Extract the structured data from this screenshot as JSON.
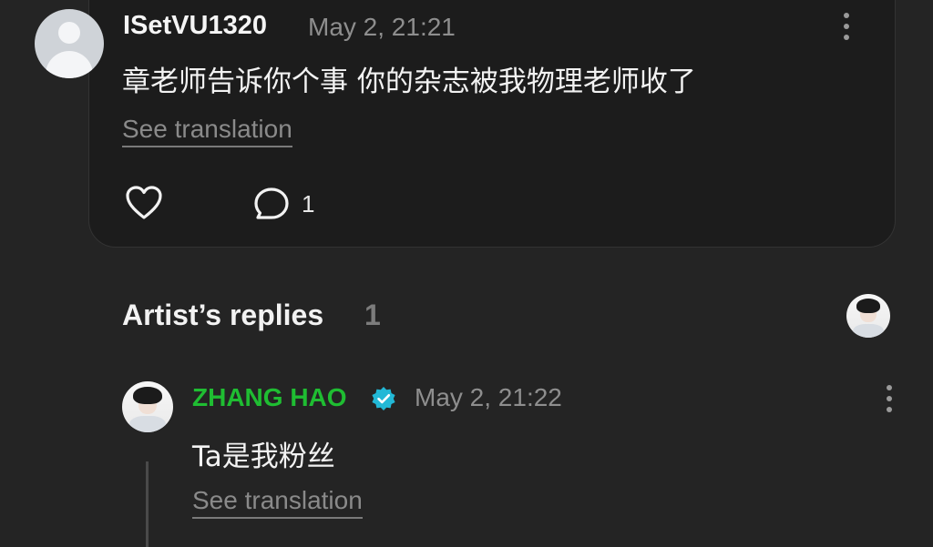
{
  "comment": {
    "username": "ISetVU1320",
    "date": "May 2, 21:21",
    "text": "章老师告诉你个事 你的杂志被我物理老师收了",
    "see_translation": "See translation",
    "reply_count": "1"
  },
  "artist_replies": {
    "title": "Artist’s replies",
    "count": "1"
  },
  "reply": {
    "username": "ZHANG HAO",
    "date": "May 2, 21:22",
    "text": "Ta是我粉丝",
    "see_translation": "See translation"
  },
  "colors": {
    "background": "#242424",
    "card": "#1c1c1c",
    "artist_name": "#1fbd32",
    "verified_badge": "#22b8d6"
  },
  "icons": [
    "user-avatar-icon",
    "more-options-icon",
    "heart-icon",
    "comment-icon",
    "verified-badge-icon"
  ]
}
